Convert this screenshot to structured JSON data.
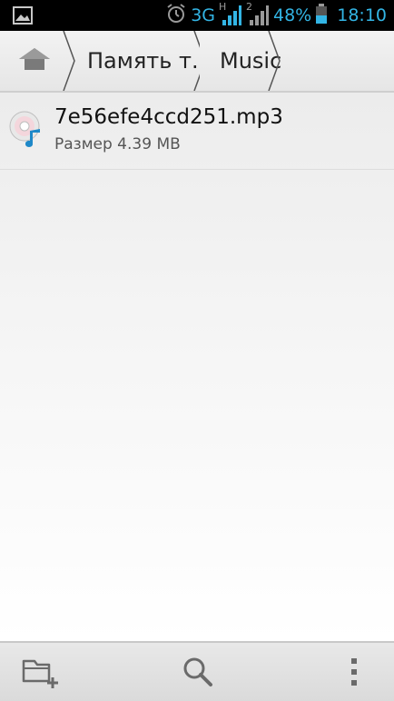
{
  "status_bar": {
    "network_type": "3G",
    "network_sub": "H",
    "sim2_label": "2",
    "battery_percent": "48%",
    "time": "18:10",
    "icons": [
      "image-notification-icon",
      "alarm-icon",
      "signal-icon",
      "battery-icon"
    ],
    "accent_color": "#33b5e5"
  },
  "breadcrumb": {
    "home_icon": "home-icon",
    "items": [
      {
        "label": "Память т..."
      },
      {
        "label": "Music"
      }
    ]
  },
  "files": [
    {
      "name": "7e56efe4ccd251.mp3",
      "size_text": "Размер 4.39 MB",
      "icon": "audio-file-icon"
    }
  ],
  "toolbar": {
    "icons": [
      "new-folder-icon",
      "search-icon",
      "overflow-menu-icon"
    ]
  }
}
